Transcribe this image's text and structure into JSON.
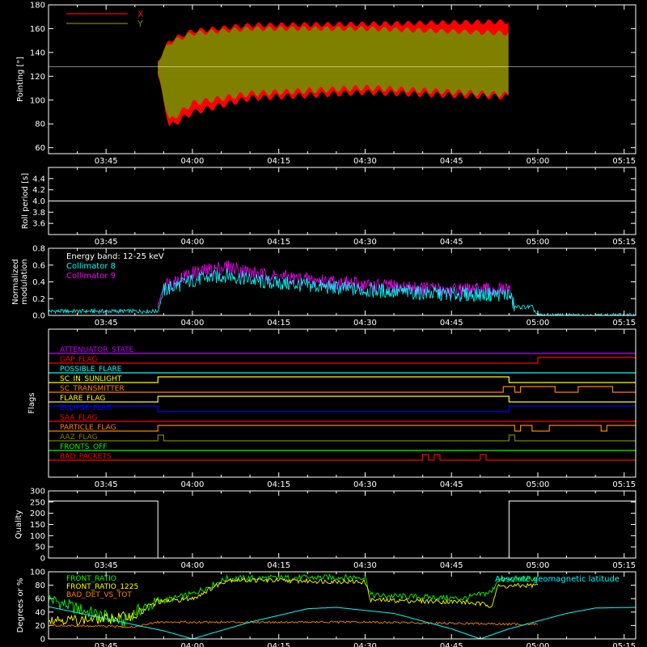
{
  "colors": {
    "background": "#000000",
    "foreground": "#ffffff",
    "x_red": "#ff0000",
    "y_olive": "#808000",
    "cyan": "#00ffff",
    "magenta": "#ff00ff",
    "green": "#00ff00",
    "yellow": "#ffff00",
    "orange": "#ff8000",
    "blue": "#0000ff",
    "purple": "#c000ff"
  },
  "time_ticks": [
    "03:45",
    "04:00",
    "04:15",
    "04:30",
    "04:45",
    "05:00",
    "05:15"
  ],
  "chart_data": [
    {
      "id": "pointing",
      "type": "area",
      "ylabel": "Pointing [\"]",
      "x_range": [
        "03:35",
        "05:17"
      ],
      "ylim": [
        55,
        180
      ],
      "yticks": [
        60,
        80,
        100,
        120,
        140,
        160,
        180
      ],
      "data_start": "03:54",
      "data_end": "04:55",
      "reference_line": 128,
      "legend": "top-left",
      "series": [
        {
          "name": "X",
          "color": "#ff0000",
          "upper": [
            [
              "03:54",
              135
            ],
            [
              "03:56",
              152
            ],
            [
              "04:00",
              160
            ],
            [
              "04:10",
              165
            ],
            [
              "04:30",
              166
            ],
            [
              "04:55",
              168
            ]
          ],
          "lower": [
            [
              "03:54",
              118
            ],
            [
              "03:56",
              75
            ],
            [
              "04:00",
              87
            ],
            [
              "04:10",
              99
            ],
            [
              "04:30",
              104
            ],
            [
              "04:55",
              100
            ]
          ]
        },
        {
          "name": "Y",
          "color": "#808000",
          "upper": [
            [
              "03:54",
              135
            ],
            [
              "03:56",
              150
            ],
            [
              "04:00",
              158
            ],
            [
              "04:10",
              162
            ],
            [
              "04:30",
              162
            ],
            [
              "04:55",
              158
            ]
          ],
          "lower": [
            [
              "03:54",
              118
            ],
            [
              "03:56",
              80
            ],
            [
              "04:00",
              95
            ],
            [
              "04:10",
              103
            ],
            [
              "04:30",
              108
            ],
            [
              "04:55",
              102
            ]
          ]
        }
      ]
    },
    {
      "id": "roll",
      "type": "line",
      "ylabel": "Roll period [s]",
      "ylim": [
        3.4,
        4.6
      ],
      "yticks": [
        "3.6",
        "3.8",
        "4.0",
        "4.2",
        "4.4"
      ],
      "series": [
        {
          "name": "",
          "color": "#ffffff",
          "values": [
            [
              "03:35",
              4.0
            ],
            [
              "05:17",
              4.0
            ]
          ]
        }
      ]
    },
    {
      "id": "modulation",
      "type": "line",
      "ylabel": [
        "Normalized",
        "modulation"
      ],
      "ylim": [
        0.0,
        0.8
      ],
      "yticks": [
        "0.0",
        "0.2",
        "0.4",
        "0.6",
        "0.8"
      ],
      "legend_title": "Energy band: 12-25 keV",
      "series": [
        {
          "name": "Collimator 8",
          "color": "#00ffff",
          "values": [
            [
              "03:35",
              0.05
            ],
            [
              "03:54",
              0.05
            ],
            [
              "03:55",
              0.3
            ],
            [
              "04:00",
              0.42
            ],
            [
              "04:06",
              0.48
            ],
            [
              "04:12",
              0.4
            ],
            [
              "04:30",
              0.3
            ],
            [
              "04:45",
              0.25
            ],
            [
              "04:55",
              0.25
            ],
            [
              "04:56",
              0.1
            ],
            [
              "04:59",
              0.1
            ],
            [
              "05:00",
              0.0
            ],
            [
              "05:17",
              0.0
            ]
          ]
        },
        {
          "name": "Collimator 9",
          "color": "#ff00ff",
          "values": [
            [
              "03:54",
              0.1
            ],
            [
              "03:55",
              0.36
            ],
            [
              "04:00",
              0.5
            ],
            [
              "04:06",
              0.58
            ],
            [
              "04:12",
              0.48
            ],
            [
              "04:30",
              0.36
            ],
            [
              "04:45",
              0.3
            ],
            [
              "04:55",
              0.3
            ],
            [
              "04:56",
              0.1
            ]
          ]
        }
      ]
    },
    {
      "id": "flags",
      "type": "line",
      "ylabel": "Flags",
      "series": [
        {
          "name": "ATTENUATOR_STATE",
          "color": "#c000ff",
          "steps": [
            [
              "03:35",
              0
            ]
          ]
        },
        {
          "name": "GAP_FLAG",
          "color": "#ff0000",
          "steps": [
            [
              "03:35",
              0
            ],
            [
              "05:00",
              1
            ]
          ]
        },
        {
          "name": "POSSIBLE_FLARE",
          "color": "#00ffff",
          "steps": [
            [
              "03:35",
              0
            ]
          ]
        },
        {
          "name": "SC_IN_SUNLIGHT",
          "color": "#ffff00",
          "steps": [
            [
              "03:35",
              0
            ],
            [
              "03:54",
              1
            ],
            [
              "04:55",
              0
            ]
          ]
        },
        {
          "name": "SC_TRANSMITTER",
          "color": "#ff8000",
          "steps": [
            [
              "03:35",
              0
            ],
            [
              "04:54",
              1
            ],
            [
              "04:56",
              0
            ],
            [
              "04:57",
              1
            ],
            [
              "05:03",
              0
            ],
            [
              "05:07",
              1
            ],
            [
              "05:13",
              0
            ],
            [
              "05:17",
              0
            ]
          ]
        },
        {
          "name": "FLARE_FLAG",
          "color": "#ffff00",
          "steps": [
            [
              "03:35",
              0
            ],
            [
              "03:54",
              1
            ],
            [
              "04:55",
              0
            ]
          ]
        },
        {
          "name": "ECLIPSE_FLAG",
          "color": "#0000ff",
          "steps": [
            [
              "03:35",
              1
            ],
            [
              "03:54",
              0
            ],
            [
              "04:55",
              1
            ]
          ]
        },
        {
          "name": "SAA_FLAG",
          "color": "#ff0000",
          "steps": [
            [
              "03:35",
              0
            ]
          ]
        },
        {
          "name": "PARTICLE_FLAG",
          "color": "#ff8000",
          "steps": [
            [
              "03:35",
              0
            ],
            [
              "03:54",
              1
            ],
            [
              "04:56",
              0
            ],
            [
              "04:57",
              1
            ],
            [
              "04:59",
              0
            ],
            [
              "05:02",
              1
            ],
            [
              "05:11",
              0
            ],
            [
              "05:12",
              1
            ],
            [
              "05:17",
              1
            ]
          ]
        },
        {
          "name": "AAZ_FLAG",
          "color": "#808000",
          "steps": [
            [
              "03:35",
              0
            ],
            [
              "03:54",
              1
            ],
            [
              "03:55",
              0
            ],
            [
              "04:55",
              1
            ],
            [
              "04:56",
              0
            ]
          ]
        },
        {
          "name": "FRONTS_OFF",
          "color": "#00ff00",
          "steps": [
            [
              "03:35",
              0
            ]
          ]
        },
        {
          "name": "BAD_PACKETS",
          "color": "#ff0000",
          "steps": [
            [
              "03:35",
              0
            ],
            [
              "04:40",
              1
            ],
            [
              "04:41",
              0
            ],
            [
              "04:42",
              1
            ],
            [
              "04:43",
              0
            ],
            [
              "04:50",
              1
            ],
            [
              "04:51",
              0
            ]
          ]
        }
      ]
    },
    {
      "id": "quality",
      "type": "line",
      "ylabel": "Quality",
      "ylim": [
        0,
        300
      ],
      "yticks": [
        "0",
        "50",
        "100",
        "150",
        "200",
        "250",
        "300"
      ],
      "series": [
        {
          "name": "",
          "color": "#ffffff",
          "values": [
            [
              "03:35",
              255
            ],
            [
              "03:54",
              255
            ],
            [
              "03:54",
              0
            ],
            [
              "04:55",
              0
            ],
            [
              "04:55",
              255
            ],
            [
              "05:17",
              255
            ]
          ]
        }
      ]
    },
    {
      "id": "ratios",
      "type": "line",
      "ylabel": "Degrees or %",
      "ylim": [
        0,
        100
      ],
      "yticks": [
        "0",
        "20",
        "40",
        "60",
        "80",
        "100"
      ],
      "series": [
        {
          "name": "FRONT_RATIO",
          "color": "#00ff00",
          "values": [
            [
              "03:35",
              60
            ],
            [
              "03:40",
              45
            ],
            [
              "03:48",
              25
            ],
            [
              "03:50",
              40
            ],
            [
              "03:54",
              55
            ],
            [
              "04:00",
              67
            ],
            [
              "04:06",
              90
            ],
            [
              "04:30",
              92
            ],
            [
              "04:31",
              65
            ],
            [
              "04:47",
              60
            ],
            [
              "04:52",
              70
            ],
            [
              "04:53",
              88
            ],
            [
              "05:00",
              90
            ]
          ]
        },
        {
          "name": "FRONT_RATIO_1225",
          "color": "#ffff00",
          "values": [
            [
              "03:35",
              30
            ],
            [
              "03:40",
              28
            ],
            [
              "03:45",
              30
            ],
            [
              "03:50",
              35
            ],
            [
              "03:54",
              55
            ],
            [
              "04:00",
              60
            ],
            [
              "04:06",
              88
            ],
            [
              "04:30",
              85
            ],
            [
              "04:31",
              58
            ],
            [
              "04:47",
              55
            ],
            [
              "04:52",
              50
            ],
            [
              "04:53",
              78
            ],
            [
              "05:00",
              80
            ]
          ]
        },
        {
          "name": "BAD_DET_VS_TOT",
          "color": "#ff8000",
          "values": [
            [
              "03:35",
              20
            ],
            [
              "03:50",
              18
            ],
            [
              "03:54",
              25
            ],
            [
              "04:30",
              25
            ],
            [
              "04:55",
              22
            ],
            [
              "05:00",
              22
            ]
          ]
        },
        {
          "name": "Absolute geomagnetic latitude",
          "color": "#00ffff",
          "values": [
            [
              "03:35",
              48
            ],
            [
              "03:45",
              30
            ],
            [
              "03:55",
              12
            ],
            [
              "04:00",
              0
            ],
            [
              "04:10",
              25
            ],
            [
              "04:20",
              45
            ],
            [
              "04:25",
              47
            ],
            [
              "04:35",
              38
            ],
            [
              "04:45",
              15
            ],
            [
              "04:50",
              0
            ],
            [
              "04:55",
              15
            ],
            [
              "05:05",
              38
            ],
            [
              "05:10",
              46
            ],
            [
              "05:17",
              47
            ]
          ]
        }
      ]
    }
  ]
}
